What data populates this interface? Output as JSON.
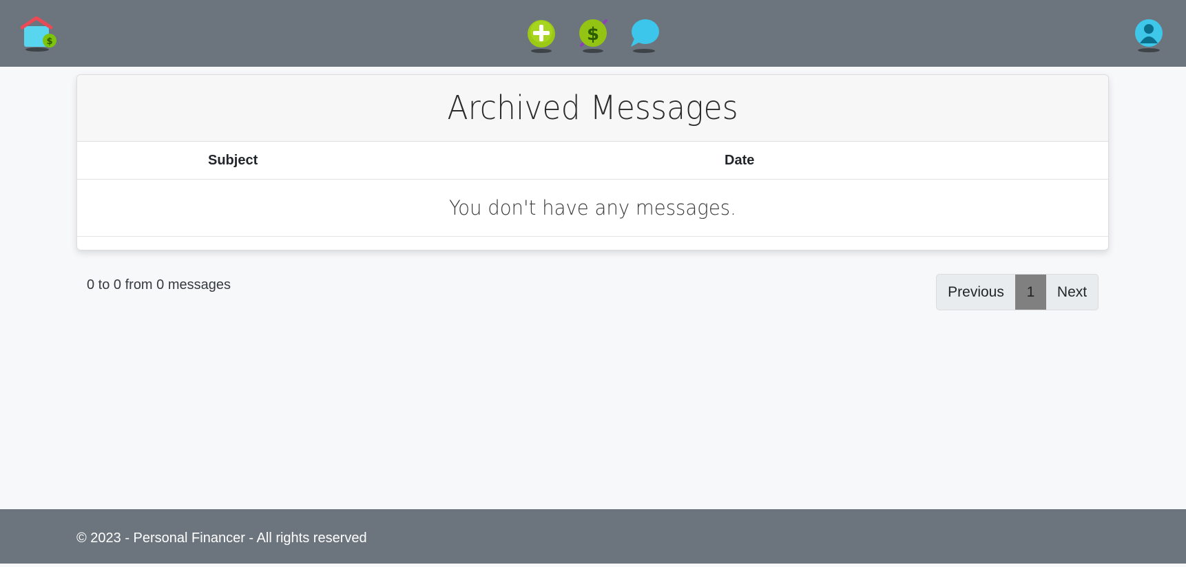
{
  "navbar": {
    "icons": [
      "home-finance-icon",
      "add-icon",
      "money-exchange-icon",
      "chat-icon",
      "user-icon"
    ]
  },
  "card": {
    "title": "Archived Messages",
    "columns": [
      "Subject",
      "Date"
    ],
    "empty_message": "You don't have any messages."
  },
  "summary": {
    "count_text": "0 to 0 from 0 messages"
  },
  "pagination": {
    "previous_label": "Previous",
    "current_page": "1",
    "next_label": "Next"
  },
  "footer": {
    "text": "© 2023 - Personal Financer - All rights reserved"
  },
  "colors": {
    "navbar_bg": "#6c757d",
    "page_bg": "#f7f8fa",
    "active_page_bg": "#808080"
  }
}
